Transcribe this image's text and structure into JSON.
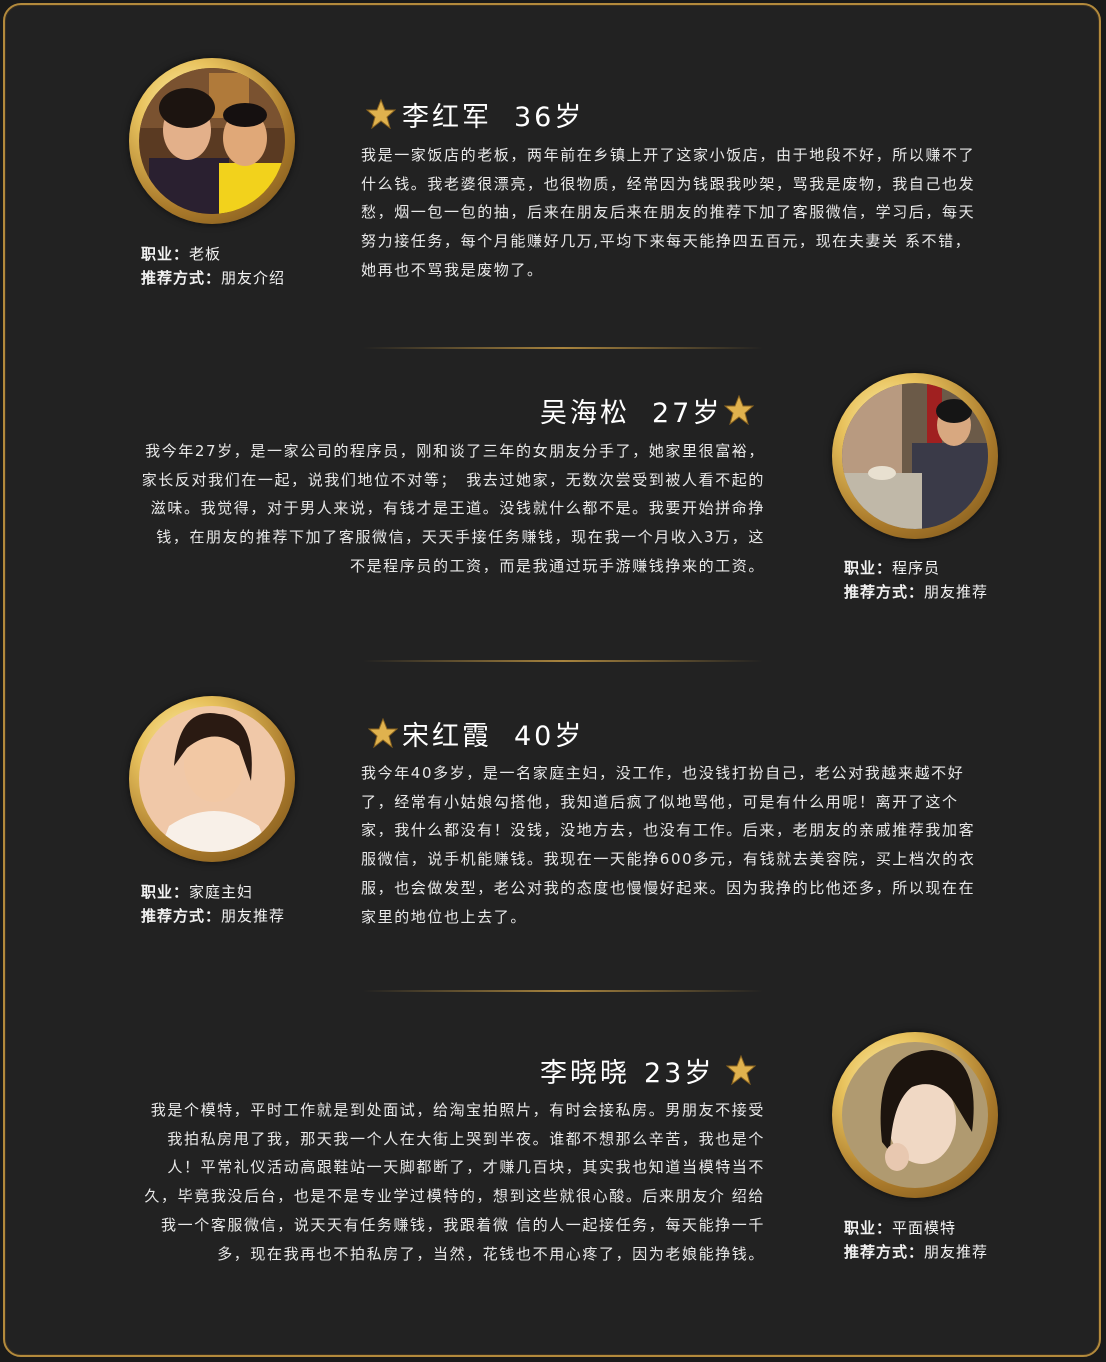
{
  "entries": [
    {
      "name": "李红军",
      "age": "36岁",
      "job_label": "职业：",
      "job": "老板",
      "rec_label": "推荐方式：",
      "rec": "朋友介绍",
      "text": "我是一家饭店的老板，两年前在乡镇上开了这家小饭店，由于地段不好，所以赚不了什么钱。我老婆很漂亮，也很物质，经常因为钱跟我吵架，骂我是废物，我自己也发愁，烟一包一包的抽，后来在朋友后来在朋友的推荐下加了客服微信，学习后，每天努力接任务，每个月能赚好几万,平均下来每天能挣四五百元，现在夫妻关 系不错，她再也不骂我是废物了。"
    },
    {
      "name": "吴海松",
      "age": "27岁",
      "job_label": "职业：",
      "job": "程序员",
      "rec_label": "推荐方式：",
      "rec": "朋友推荐",
      "text": "我今年27岁，是一家公司的程序员，刚和谈了三年的女朋友分手了，她家里很富裕，家长反对我们在一起，说我们地位不对等；　我去过她家，无数次尝受到被人看不起的滋味。我觉得，对于男人来说，有钱才是王道。没钱就什么都不是。我要开始拼命挣钱，在朋友的推荐下加了客服微信，天天手接任务赚钱，现在我一个月收入3万，这不是程序员的工资，而是我通过玩手游赚钱挣来的工资。"
    },
    {
      "name": "宋红霞",
      "age": "40岁",
      "job_label": "职业：",
      "job": "家庭主妇",
      "rec_label": "推荐方式：",
      "rec": "朋友推荐",
      "text": "我今年40多岁，是一名家庭主妇，没工作，也没钱打扮自己，老公对我越来越不好了，经常有小姑娘勾搭他，我知道后疯了似地骂他，可是有什么用呢！离开了这个家，我什么都没有！没钱，没地方去，也没有工作。后来，老朋友的亲戚推荐我加客服微信，说手机能赚钱。我现在一天能挣600多元，有钱就去美容院，买上档次的衣服，也会做发型，老公对我的态度也慢慢好起来。因为我挣的比他还多，所以现在在家里的地位也上去了。"
    },
    {
      "name": "李晓晓",
      "age": "23岁",
      "job_label": "职业：",
      "job": "平面模特",
      "rec_label": "推荐方式：",
      "rec": "朋友推荐",
      "text": "我是个模特，平时工作就是到处面试，给淘宝拍照片，有时会接私房。男朋友不接受我拍私房甩了我，那天我一个人在大街上哭到半夜。谁都不想那么辛苦，我也是个人！平常礼仪活动高跟鞋站一天脚都断了，才赚几百块，其实我也知道当模特当不久，毕竟我没后台，也是不是专业学过模特的，想到这些就很心酸。后来朋友介 绍给我一个客服微信，说天天有任务赚钱，我跟着微 信的人一起接任务，每天能挣一千多，现在我再也不拍私房了，当然，花钱也不用心疼了，因为老娘能挣钱。"
    }
  ],
  "colors": {
    "gold": "#c9a14a",
    "background": "#222222"
  }
}
